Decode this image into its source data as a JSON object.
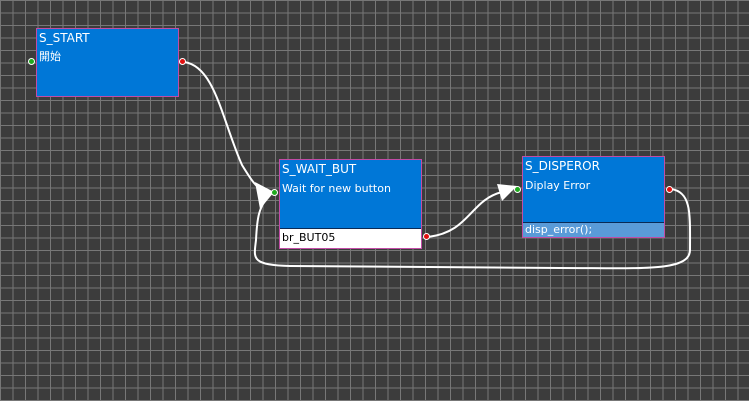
{
  "nodes": [
    {
      "id": "S_START",
      "title": "S_START",
      "description": "開始"
    },
    {
      "id": "S_WAIT_BUT",
      "title": "S_WAIT_BUT",
      "description": "Wait for new button",
      "footer": "br_BUT05"
    },
    {
      "id": "S_DISPEROR",
      "title": "S_DISPEROR",
      "description": "Diplay Error",
      "footer": "disp_error();"
    }
  ],
  "links": [
    {
      "from": "S_START",
      "to": "S_WAIT_BUT"
    },
    {
      "from": "S_WAIT_BUT",
      "to": "S_DISPEROR"
    },
    {
      "from": "S_DISPEROR",
      "to": "S_WAIT_BUT"
    }
  ],
  "colors": {
    "canvas_background": "#3c3c3c",
    "grid_line": "#777777",
    "node_fill": "#0077d7",
    "node_border": "#c24ca6",
    "port_in": "#1faa1f",
    "port_out": "#e01010",
    "link": "#ffffff"
  }
}
